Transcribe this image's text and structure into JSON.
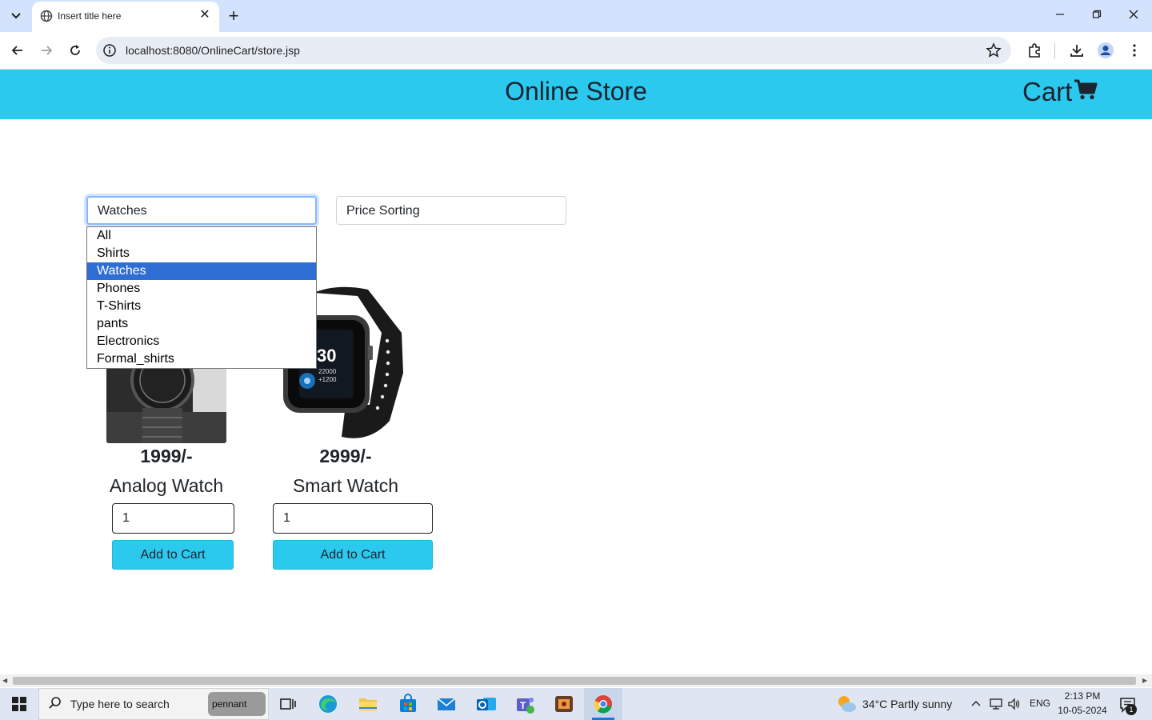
{
  "browser": {
    "tab_title": "Insert title here",
    "url": "localhost:8080/OnlineCart/store.jsp"
  },
  "header": {
    "title": "Online Store",
    "cart_label": "Cart"
  },
  "filters": {
    "category_value": "Watches",
    "price_value": "Price Sorting",
    "category_options": [
      "All",
      "Shirts",
      "Watches",
      "Phones",
      "T-Shirts",
      "pants",
      "Electronics",
      "Formal_shirts"
    ],
    "selected_index": 2
  },
  "products": [
    {
      "price": "1999/-",
      "name": "Analog Watch",
      "quantity": "1",
      "button": "Add to Cart"
    },
    {
      "price": "2999/-",
      "name": "Smart Watch",
      "quantity": "1",
      "button": "Add to Cart"
    }
  ],
  "taskbar": {
    "search_placeholder": "Type here to search",
    "pennant_label": "pennant",
    "weather": "34°C  Partly sunny",
    "language": "ENG",
    "time": "2:13 PM",
    "date": "10-05-2024",
    "notification_count": "1"
  },
  "colors": {
    "header_bg": "#2bc9ed",
    "selected_option_bg": "#2f6fd5"
  }
}
